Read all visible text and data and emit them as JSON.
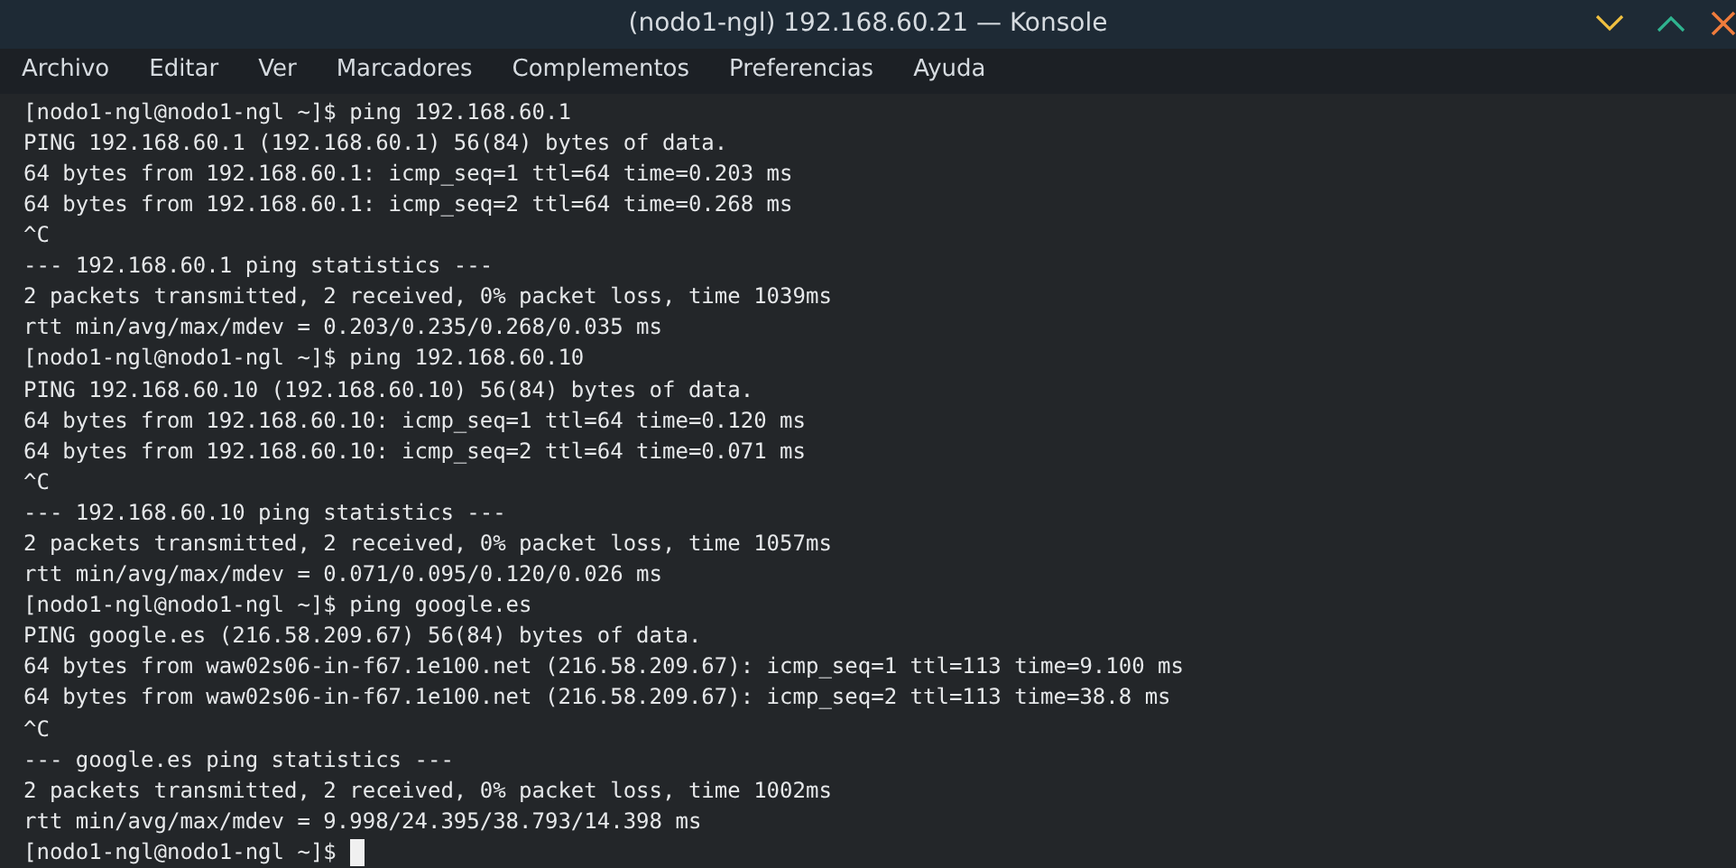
{
  "window": {
    "title": "(nodo1-ngl) 192.168.60.21 — Konsole"
  },
  "menu": [
    "Archivo",
    "Editar",
    "Ver",
    "Marcadores",
    "Complementos",
    "Preferencias",
    "Ayuda"
  ],
  "terminal": {
    "lines": [
      "[nodo1-ngl@nodo1-ngl ~]$ ping 192.168.60.1",
      "PING 192.168.60.1 (192.168.60.1) 56(84) bytes of data.",
      "64 bytes from 192.168.60.1: icmp_seq=1 ttl=64 time=0.203 ms",
      "64 bytes from 192.168.60.1: icmp_seq=2 ttl=64 time=0.268 ms",
      "^C",
      "--- 192.168.60.1 ping statistics ---",
      "2 packets transmitted, 2 received, 0% packet loss, time 1039ms",
      "rtt min/avg/max/mdev = 0.203/0.235/0.268/0.035 ms",
      "[nodo1-ngl@nodo1-ngl ~]$ ping 192.168.60.10",
      "PING 192.168.60.10 (192.168.60.10) 56(84) bytes of data.",
      "64 bytes from 192.168.60.10: icmp_seq=1 ttl=64 time=0.120 ms",
      "64 bytes from 192.168.60.10: icmp_seq=2 ttl=64 time=0.071 ms",
      "^C",
      "--- 192.168.60.10 ping statistics ---",
      "2 packets transmitted, 2 received, 0% packet loss, time 1057ms",
      "rtt min/avg/max/mdev = 0.071/0.095/0.120/0.026 ms",
      "[nodo1-ngl@nodo1-ngl ~]$ ping google.es",
      "PING google.es (216.58.209.67) 56(84) bytes of data.",
      "64 bytes from waw02s06-in-f67.1e100.net (216.58.209.67): icmp_seq=1 ttl=113 time=9.100 ms",
      "64 bytes from waw02s06-in-f67.1e100.net (216.58.209.67): icmp_seq=2 ttl=113 time=38.8 ms",
      "^C",
      "--- google.es ping statistics ---",
      "2 packets transmitted, 2 received, 0% packet loss, time 1002ms",
      "rtt min/avg/max/mdev = 9.998/24.395/38.793/14.398 ms"
    ],
    "prompt": "[nodo1-ngl@nodo1-ngl ~]$"
  }
}
